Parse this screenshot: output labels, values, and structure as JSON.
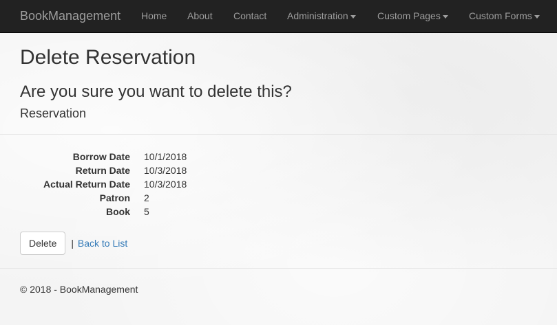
{
  "navbar": {
    "brand": "BookManagement",
    "items": [
      {
        "label": "Home"
      },
      {
        "label": "About"
      },
      {
        "label": "Contact"
      },
      {
        "label": "Administration"
      },
      {
        "label": "Custom Pages"
      },
      {
        "label": "Custom Forms"
      }
    ]
  },
  "page": {
    "title": "Delete Reservation",
    "question": "Are you sure you want to delete this?",
    "entity": "Reservation"
  },
  "details": [
    {
      "label": "Borrow Date",
      "value": "10/1/2018"
    },
    {
      "label": "Return Date",
      "value": "10/3/2018"
    },
    {
      "label": "Actual Return Date",
      "value": "10/3/2018"
    },
    {
      "label": "Patron",
      "value": "2"
    },
    {
      "label": "Book",
      "value": "5"
    }
  ],
  "actions": {
    "delete_label": "Delete",
    "separator": "|",
    "back_label": "Back to List"
  },
  "footer": {
    "text": "© 2018 - BookManagement"
  }
}
